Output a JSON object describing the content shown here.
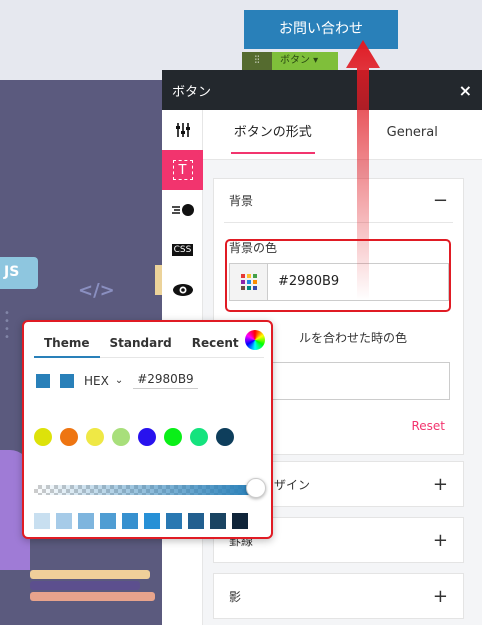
{
  "page": {
    "contact_button": "お問い合わせ",
    "widget_name": "ボタン ▾",
    "badge_js": "JS",
    "badge_code": "</>"
  },
  "panel": {
    "title": "ボタン",
    "close": "×",
    "side_icons": [
      "sliders-icon",
      "text-style-icon",
      "animation-icon",
      "css-icon",
      "visibility-icon"
    ],
    "tabs": [
      {
        "label": "ボタンの形式",
        "active": true
      },
      {
        "label": "General",
        "active": false
      }
    ],
    "background_section": {
      "title": "背景",
      "toggle": "−",
      "color_label": "背景の色",
      "color_value": "#2980B9",
      "hover_label": "ルを合わせた時の色",
      "reset": "Reset"
    },
    "sections": [
      {
        "title": "ザイン",
        "toggle": "+"
      },
      {
        "title": "罫線",
        "toggle": "+"
      },
      {
        "title": "影",
        "toggle": "+"
      }
    ]
  },
  "picker": {
    "tabs": [
      "Theme",
      "Standard",
      "Recent"
    ],
    "active_tab": "Theme",
    "format": "HEX",
    "hex": "#2980B9",
    "theme_colors": [
      "#dde20a",
      "#ee7512",
      "#efe845",
      "#a8df7b",
      "#2812ee",
      "#0aef18",
      "#15e37e",
      "#0e3e5c"
    ],
    "shades": [
      "#c8dff0",
      "#a6cbe8",
      "#7eb5de",
      "#4f9dd3",
      "#3690cf",
      "#2790d6",
      "#2978b2",
      "#225f8f",
      "#1a4462",
      "#10253a"
    ]
  },
  "colors": {
    "accent": "#f2346e",
    "primary": "#2980b9",
    "highlight": "#e01b24"
  }
}
